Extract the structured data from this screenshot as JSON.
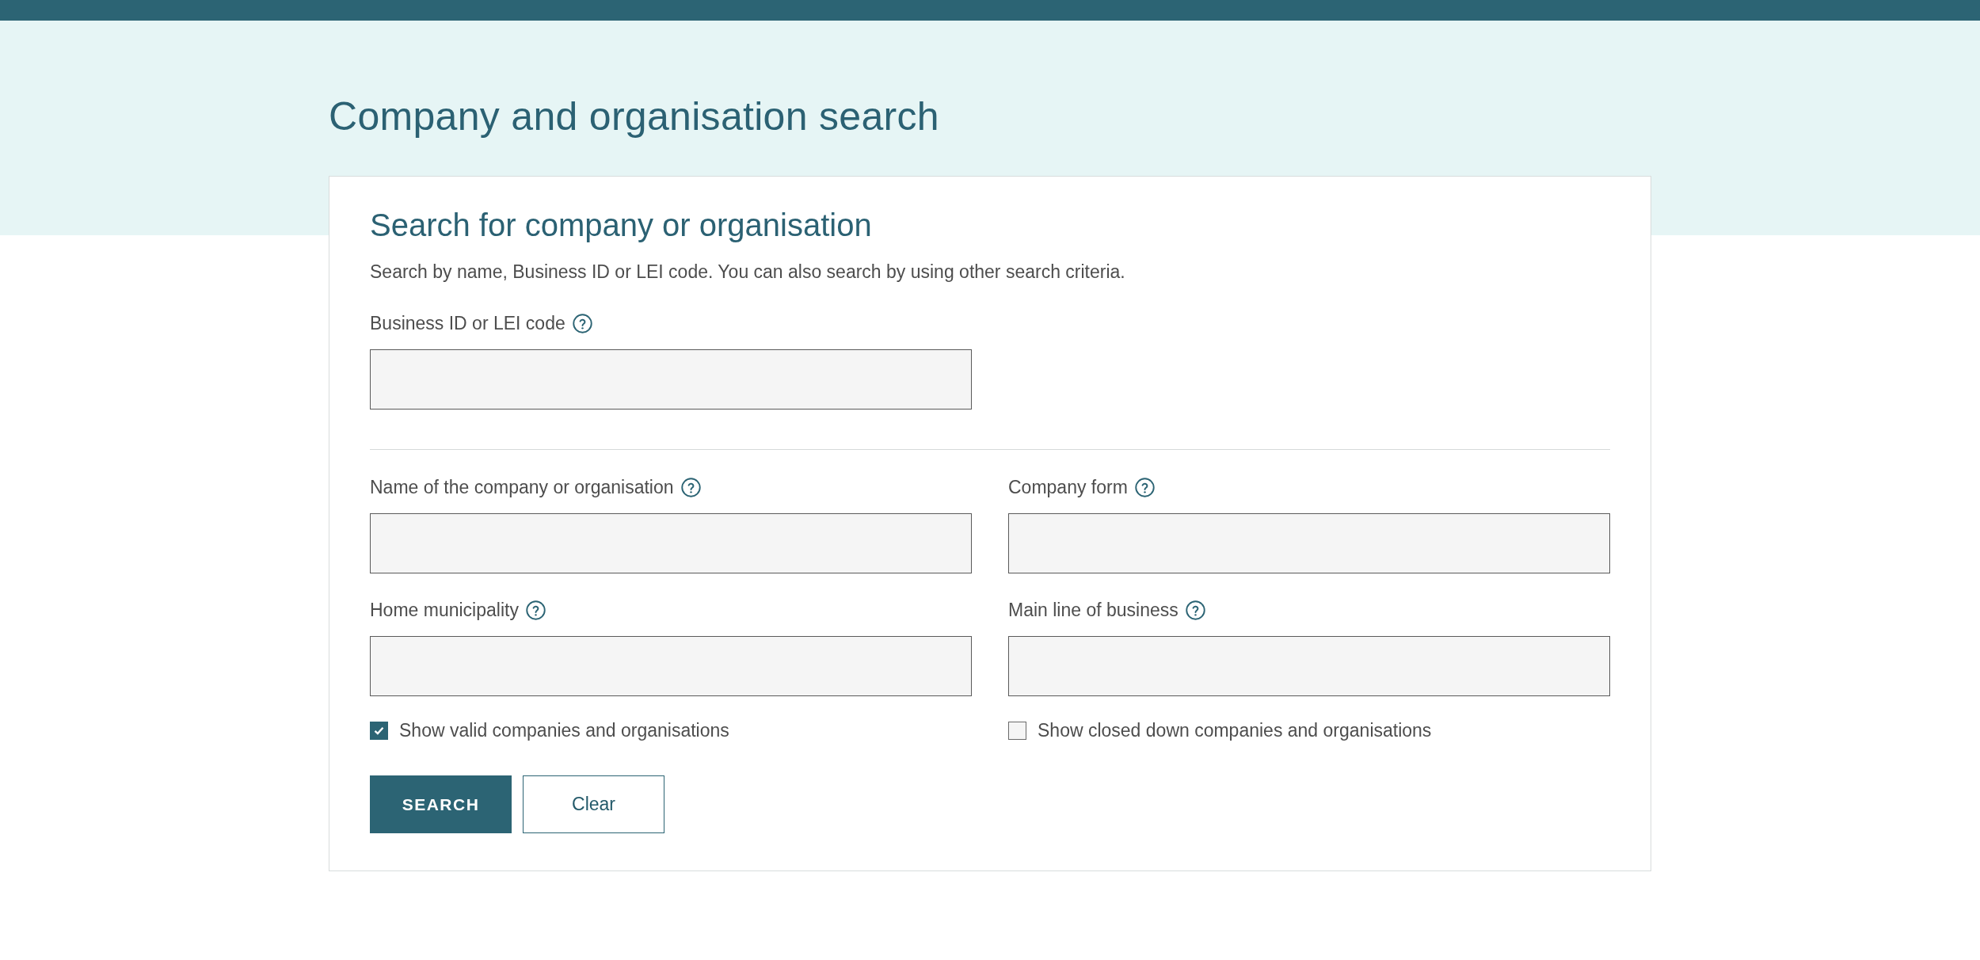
{
  "page_title": "Company and organisation search",
  "search_card": {
    "title": "Search for company or organisation",
    "description": "Search by name, Business ID or LEI code. You can also search by using other search criteria.",
    "sections": [
      {
        "fields": [
          {
            "label": "Business ID or LEI code"
          }
        ]
      },
      {
        "fields": [
          {
            "label": "Name of the company or organisation"
          },
          {
            "label": "Company form"
          },
          {
            "label": "Home municipality"
          },
          {
            "label": "Main line of business"
          }
        ]
      }
    ],
    "checkboxes": [
      {
        "label": "Show valid companies and organisations",
        "checked": true
      },
      {
        "label": "Show closed down companies and organisations",
        "checked": false
      }
    ],
    "buttons": [
      {
        "label": "SEARCH",
        "kind": "primary"
      },
      {
        "label": "Clear",
        "kind": "secondary"
      }
    ]
  }
}
